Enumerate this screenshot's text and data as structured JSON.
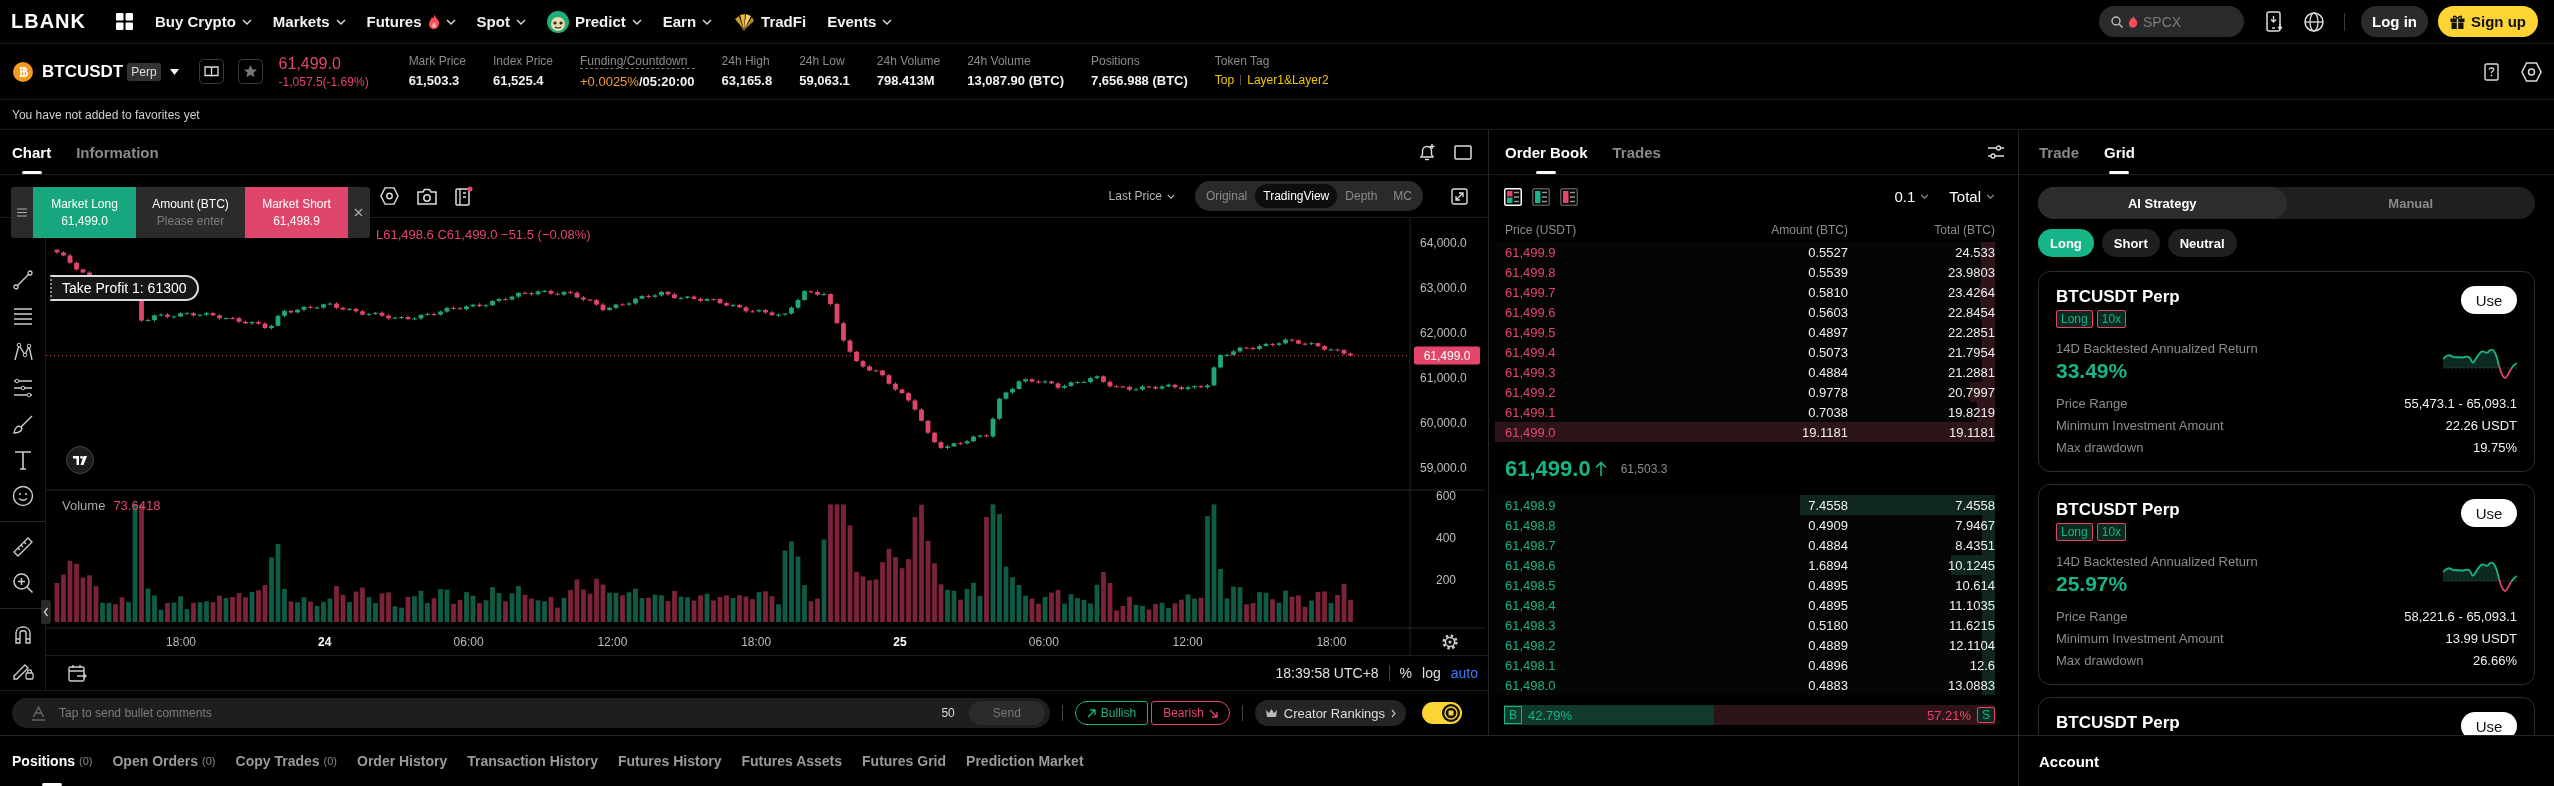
{
  "nav": {
    "logo": "LBANK",
    "menu": [
      {
        "label": "Buy Crypto",
        "kind": "plain",
        "dropdown": true
      },
      {
        "label": "Markets",
        "kind": "plain",
        "dropdown": true
      },
      {
        "label": "Futures",
        "kind": "hot",
        "dropdown": true
      },
      {
        "label": "Spot",
        "kind": "plain",
        "dropdown": true
      },
      {
        "label": "Predict",
        "kind": "predict",
        "dropdown": true
      },
      {
        "label": "Earn",
        "kind": "plain",
        "dropdown": true
      },
      {
        "label": "TradFi",
        "kind": "tradfi",
        "dropdown": false
      },
      {
        "label": "Events",
        "kind": "plain",
        "dropdown": true
      }
    ],
    "search": {
      "placeholder": "SPCX"
    },
    "login": "Log in",
    "signup": "Sign up"
  },
  "ticker": {
    "symbol": "BTCUSDT",
    "contract": "Perp",
    "favorite": false,
    "price": "61,499.0",
    "change": "-1,057.5(-1.69%)",
    "rising": false,
    "stats": [
      {
        "kind": "value",
        "label": "Mark Price",
        "value": "61,503.3"
      },
      {
        "kind": "value",
        "label": "Index Price",
        "value": "61,525.4"
      },
      {
        "kind": "funding",
        "label": "Funding/Countdown",
        "rate": "+0.0025%",
        "countdown": "/05:20:00"
      },
      {
        "kind": "value",
        "label": "24h High",
        "value": "63,165.8"
      },
      {
        "kind": "value",
        "label": "24h Low",
        "value": "59,063.1"
      },
      {
        "kind": "value",
        "label": "24h Volume",
        "value": "798.413M"
      },
      {
        "kind": "value",
        "label": "24h Volume",
        "value": "13,087.90 (BTC)"
      },
      {
        "kind": "value",
        "label": "Positions",
        "value": "7,656.988 (BTC)"
      },
      {
        "kind": "tags",
        "label": "Token Tag",
        "tags": [
          "Top",
          "Layer1&Layer2"
        ]
      }
    ]
  },
  "favorites_notice": "You have not added to favorites yet",
  "chart_panel": {
    "tabs": [
      {
        "label": "Chart",
        "selected": true
      },
      {
        "label": "Information",
        "selected": false
      }
    ],
    "quick_trade": {
      "long_label": "Market Long",
      "long_price": "61,499.0",
      "amount_label": "Amount (BTC)",
      "amount_placeholder": "Please enter",
      "short_label": "Market Short",
      "short_price": "61,498.9"
    },
    "price_source": "Last Price",
    "views": [
      {
        "label": "Original",
        "selected": false
      },
      {
        "label": "TradingView",
        "selected": true
      },
      {
        "label": "Depth",
        "selected": false
      },
      {
        "label": "MC",
        "selected": false
      }
    ],
    "legend": "L61,498.6 C61,499.0 −51.5 (−0.08%)",
    "take_profit": "Take Profit 1: 61300",
    "last_price": "61,499.0",
    "price_axis": [
      "64,000.0",
      "63,000.0",
      "62,000.0",
      "61,000.0",
      "60,000.0",
      "59,000.0"
    ],
    "volume_label": "Volume",
    "volume_value": "73.6418",
    "volume_axis": [
      "600",
      "400",
      "200"
    ],
    "time_axis": [
      {
        "label": "18:00",
        "kind": "time"
      },
      {
        "label": "24",
        "kind": "day"
      },
      {
        "label": "06:00",
        "kind": "time"
      },
      {
        "label": "12:00",
        "kind": "time"
      },
      {
        "label": "18:00",
        "kind": "time"
      },
      {
        "label": "25",
        "kind": "day"
      },
      {
        "label": "06:00",
        "kind": "time"
      },
      {
        "label": "12:00",
        "kind": "time"
      },
      {
        "label": "18:00",
        "kind": "time"
      }
    ],
    "clock": "18:39:58 UTC+8",
    "scale_options": [
      {
        "label": "%",
        "selected": false
      },
      {
        "label": "log",
        "selected": false
      },
      {
        "label": "auto",
        "selected": true
      }
    ]
  },
  "comments": {
    "placeholder": "Tap to send bullet comments",
    "limit": "50",
    "send": "Send",
    "bullish": "Bullish",
    "bearish": "Bearish",
    "rankings": "Creator Rankings",
    "enabled": true
  },
  "order_book": {
    "tabs": [
      {
        "label": "Order Book",
        "selected": true
      },
      {
        "label": "Trades",
        "selected": false
      }
    ],
    "layouts": [
      {
        "kind": "both",
        "selected": true
      },
      {
        "kind": "bids",
        "selected": false
      },
      {
        "kind": "asks",
        "selected": false
      }
    ],
    "precision": "0.1",
    "mode": "Total",
    "columns": [
      "Price (USDT)",
      "Amount (BTC)",
      "Total (BTC)"
    ],
    "asks": [
      {
        "price": "61,499.9",
        "amount": "0.5527",
        "total": "24.533",
        "level": 0.029
      },
      {
        "price": "61,499.8",
        "amount": "0.5539",
        "total": "23.9803",
        "level": 0.029
      },
      {
        "price": "61,499.7",
        "amount": "0.5810",
        "total": "23.4264",
        "level": 0.03
      },
      {
        "price": "61,499.6",
        "amount": "0.5603",
        "total": "22.8454",
        "level": 0.029
      },
      {
        "price": "61,499.5",
        "amount": "0.4897",
        "total": "22.2851",
        "level": 0.026
      },
      {
        "price": "61,499.4",
        "amount": "0.5073",
        "total": "21.7954",
        "level": 0.027
      },
      {
        "price": "61,499.3",
        "amount": "0.4884",
        "total": "21.2881",
        "level": 0.026
      },
      {
        "price": "61,499.2",
        "amount": "0.9778",
        "total": "20.7997",
        "level": 0.051
      },
      {
        "price": "61,499.1",
        "amount": "0.7038",
        "total": "19.8219",
        "level": 0.037
      },
      {
        "price": "61,499.0",
        "amount": "19.1181",
        "total": "19.1181",
        "level": 1
      }
    ],
    "last_price": "61,499.0",
    "rising": true,
    "mark_price": "61,503.3",
    "bids": [
      {
        "price": "61,498.9",
        "amount": "7.4558",
        "total": "7.4558",
        "level": 0.39
      },
      {
        "price": "61,498.8",
        "amount": "0.4909",
        "total": "7.9467",
        "level": 0.026
      },
      {
        "price": "61,498.7",
        "amount": "0.4884",
        "total": "8.4351",
        "level": 0.026
      },
      {
        "price": "61,498.6",
        "amount": "1.6894",
        "total": "10.1245",
        "level": 0.088
      },
      {
        "price": "61,498.5",
        "amount": "0.4895",
        "total": "10.614",
        "level": 0.026
      },
      {
        "price": "61,498.4",
        "amount": "0.4895",
        "total": "11.1035",
        "level": 0.026
      },
      {
        "price": "61,498.3",
        "amount": "0.5180",
        "total": "11.6215",
        "level": 0.027
      },
      {
        "price": "61,498.2",
        "amount": "0.4889",
        "total": "12.1104",
        "level": 0.026
      },
      {
        "price": "61,498.1",
        "amount": "0.4896",
        "total": "12.6",
        "level": 0.026
      },
      {
        "price": "61,498.0",
        "amount": "0.4883",
        "total": "13.0883",
        "level": 0.026
      }
    ],
    "buy_ratio": {
      "tag": "B",
      "value": "42.79%",
      "level": 0.4279
    },
    "sell_ratio": {
      "tag": "S",
      "value": "57.21%"
    }
  },
  "grid_panel": {
    "tabs": [
      {
        "label": "Trade",
        "selected": false
      },
      {
        "label": "Grid",
        "selected": true
      }
    ],
    "modes": [
      {
        "label": "AI Strategy",
        "selected": true
      },
      {
        "label": "Manual",
        "selected": false
      }
    ],
    "directions": [
      {
        "label": "Long",
        "selected": true
      },
      {
        "label": "Short",
        "selected": false
      },
      {
        "label": "Neutral",
        "selected": false
      }
    ],
    "strategies": [
      {
        "name": "BTCUSDT Perp",
        "tags": [
          "Long",
          "10x"
        ],
        "action": "Use",
        "return_label": "14D Backtested Annualized Return",
        "return": "33.49%",
        "details": [
          {
            "label": "Price Range",
            "value": "55,473.1 - 65,093.1"
          },
          {
            "label": "Minimum Investment Amount",
            "value": "22.26 USDT"
          },
          {
            "label": "Max drawdown",
            "value": "19.75%"
          }
        ]
      },
      {
        "name": "BTCUSDT Perp",
        "tags": [
          "Long",
          "10x"
        ],
        "action": "Use",
        "return_label": "14D Backtested Annualized Return",
        "return": "25.97%",
        "details": [
          {
            "label": "Price Range",
            "value": "58,221.6 - 65,093.1"
          },
          {
            "label": "Minimum Investment Amount",
            "value": "13.99 USDT"
          },
          {
            "label": "Max drawdown",
            "value": "26.66%"
          }
        ]
      },
      {
        "name": "BTCUSDT Perp",
        "action": "Use"
      }
    ]
  },
  "bottom_tabs": [
    {
      "label": "Positions",
      "count": "(0)",
      "selected": true
    },
    {
      "label": "Open Orders",
      "count": "(0)",
      "selected": false
    },
    {
      "label": "Copy Trades",
      "count": "(0)",
      "selected": false
    },
    {
      "label": "Order History",
      "selected": false
    },
    {
      "label": "Transaction History",
      "selected": false
    },
    {
      "label": "Futures History",
      "selected": false
    },
    {
      "label": "Futures Assets",
      "selected": false
    },
    {
      "label": "Futures Grid",
      "selected": false
    },
    {
      "label": "Prediction Market",
      "selected": false
    }
  ],
  "account": {
    "title": "Account"
  }
}
